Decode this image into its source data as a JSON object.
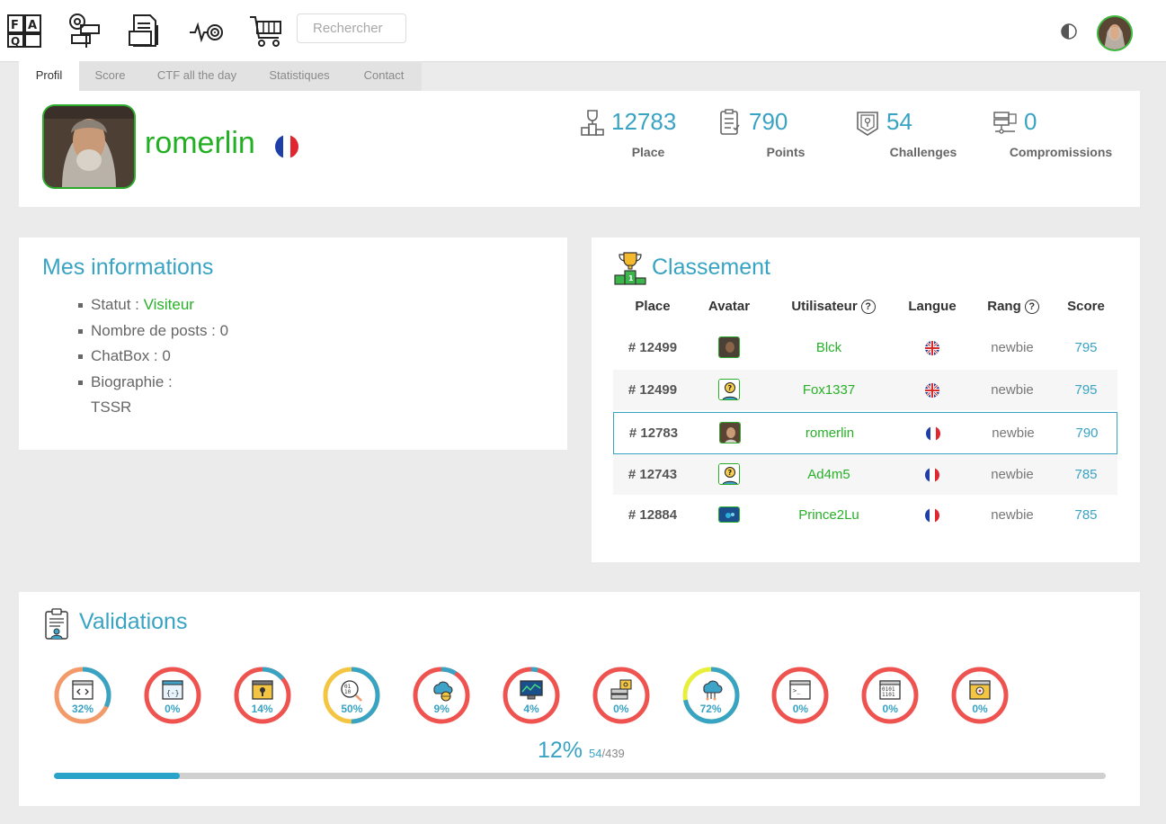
{
  "topbar": {
    "icons": [
      "faq-icon",
      "signpost-icon",
      "documents-icon",
      "target-icon",
      "cart-icon"
    ],
    "search_placeholder": "Rechercher"
  },
  "tabs": [
    {
      "label": "Profil",
      "active": true
    },
    {
      "label": "Score",
      "active": false
    },
    {
      "label": "CTF all the day",
      "active": false
    },
    {
      "label": "Statistiques",
      "active": false
    },
    {
      "label": "Contact",
      "active": false
    }
  ],
  "profile": {
    "username": "romerlin",
    "country_flag": "fr",
    "stats": [
      {
        "icon": "podium-icon",
        "value": "12783",
        "label": "Place"
      },
      {
        "icon": "checklist-icon",
        "value": "790",
        "label": "Points"
      },
      {
        "icon": "badge-icon",
        "value": "54",
        "label": "Challenges"
      },
      {
        "icon": "servers-icon",
        "value": "0",
        "label": "Compromissions"
      }
    ]
  },
  "infos": {
    "title": "Mes informations",
    "statut_label": "Statut : ",
    "statut_value": "Visiteur",
    "posts": "Nombre de posts : 0",
    "chatbox": "ChatBox : 0",
    "bio_label": "Biographie :",
    "bio_value": "TSSR"
  },
  "classement": {
    "title": "Classement",
    "headers": {
      "place": "Place",
      "avatar": "Avatar",
      "user": "Utilisateur",
      "langue": "Langue",
      "rang": "Rang",
      "score": "Score",
      "help": "?"
    },
    "rows": [
      {
        "place": "# 12499",
        "avatar": "photo",
        "user": "Blck",
        "flag": "gb",
        "rang": "newbie",
        "score": "795"
      },
      {
        "place": "# 12499",
        "avatar": "default",
        "user": "Fox1337",
        "flag": "gb",
        "rang": "newbie",
        "score": "795"
      },
      {
        "place": "# 12783",
        "avatar": "photo",
        "user": "romerlin",
        "flag": "fr",
        "rang": "newbie",
        "score": "790",
        "me": true
      },
      {
        "place": "# 12743",
        "avatar": "default",
        "user": "Ad4m5",
        "flag": "fr",
        "rang": "newbie",
        "score": "785"
      },
      {
        "place": "# 12884",
        "avatar": "blue",
        "user": "Prince2Lu",
        "flag": "fr",
        "rang": "newbie",
        "score": "785"
      }
    ]
  },
  "validations": {
    "title": "Validations",
    "categories": [
      {
        "icon": "web-client-icon",
        "percent": 32,
        "label": "32%",
        "color": "#f39a6a"
      },
      {
        "icon": "web-server-icon",
        "percent": 0,
        "label": "0%",
        "color": "#ef5350"
      },
      {
        "icon": "cryptanalysis-icon",
        "percent": 14,
        "label": "14%",
        "color": "#ef5350"
      },
      {
        "icon": "steganography-icon",
        "percent": 50,
        "label": "50%",
        "color": "#f4c542"
      },
      {
        "icon": "network-icon",
        "percent": 9,
        "label": "9%",
        "color": "#ef5350"
      },
      {
        "icon": "forensic-icon",
        "percent": 4,
        "label": "4%",
        "color": "#ef5350"
      },
      {
        "icon": "app-system-icon",
        "percent": 0,
        "label": "0%",
        "color": "#ef5350"
      },
      {
        "icon": "programming-icon",
        "percent": 72,
        "label": "72%",
        "color": "#e8ef3a"
      },
      {
        "icon": "app-script-icon",
        "percent": 0,
        "label": "0%",
        "color": "#ef5350"
      },
      {
        "icon": "cracking-icon",
        "percent": 0,
        "label": "0%",
        "color": "#ef5350"
      },
      {
        "icon": "realist-icon",
        "percent": 0,
        "label": "0%",
        "color": "#ef5350"
      }
    ],
    "progress_label": "12%",
    "progress_percent": 12,
    "done": "54",
    "total": "439"
  },
  "colors": {
    "accent": "#39a3c3",
    "green": "#28b028",
    "red": "#ef5350"
  }
}
